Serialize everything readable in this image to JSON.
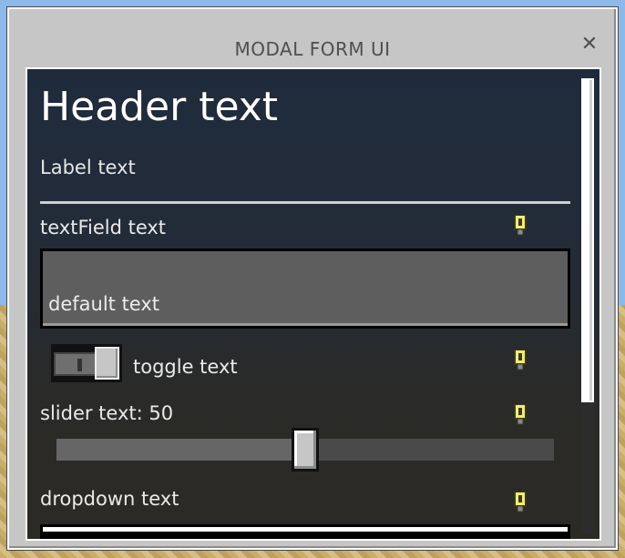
{
  "window": {
    "title": "MODAL FORM UI"
  },
  "form": {
    "header": "Header text",
    "label": "Label text",
    "text_field": {
      "label": "textField text",
      "value": "default text"
    },
    "toggle": {
      "label": "toggle text",
      "state": "on"
    },
    "slider": {
      "label": "slider text: 50",
      "value": 50,
      "min": 0,
      "max": 100
    },
    "dropdown": {
      "label": "dropdown text"
    }
  },
  "icons": [
    "close-icon",
    "info-icon"
  ],
  "colors": {
    "panel": "#c6c6c6",
    "content_bg": "#232b37",
    "info_icon": "#f0e060"
  }
}
